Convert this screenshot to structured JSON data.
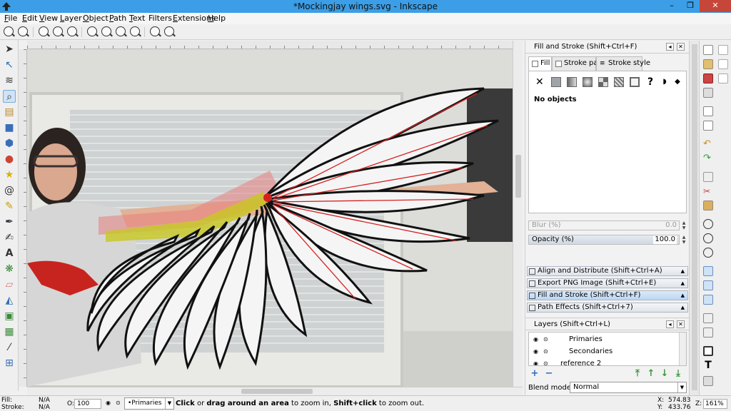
{
  "window": {
    "title": "*Mockingjay wings.svg - Inkscape",
    "minimize": "–",
    "maximize": "❐",
    "close": "✕"
  },
  "menu": [
    {
      "u": "F",
      "rest": "ile"
    },
    {
      "u": "E",
      "rest": "dit"
    },
    {
      "u": "V",
      "rest": "iew"
    },
    {
      "u": "L",
      "rest": "ayer"
    },
    {
      "u": "O",
      "rest": "bject"
    },
    {
      "u": "P",
      "rest": "ath"
    },
    {
      "u": "T",
      "rest": "ext"
    },
    {
      "u": "",
      "rest": "Filters"
    },
    {
      "u": "E",
      "rest": "xtensions"
    },
    {
      "u": "H",
      "rest": "elp"
    }
  ],
  "fill_stroke": {
    "header": "Fill and Stroke (Shift+Ctrl+F)",
    "tabs": {
      "fill": "Fill",
      "stroke_paint": "Stroke paint",
      "stroke_style": "Stroke style"
    },
    "no_objects": "No objects",
    "blur_label": "Blur (%)",
    "blur_value": "0.0",
    "opacity_label": "Opacity (%)",
    "opacity_value": "100.0"
  },
  "docks": {
    "align": "Align and Distribute (Shift+Ctrl+A)",
    "export": "Export PNG Image (Shift+Ctrl+E)",
    "fill_stroke": "Fill and Stroke (Shift+Ctrl+F)",
    "path_effects": "Path Effects  (Shift+Ctrl+7)",
    "layers": "Layers (Shift+Ctrl+L)"
  },
  "layers": {
    "items": [
      "Primaries",
      "Secondaries",
      "reference 2"
    ],
    "blend_label": "Blend mode:",
    "blend_value": "Normal"
  },
  "status": {
    "fill_label": "Fill:",
    "stroke_label": "Stroke:",
    "fill_value": "N/A",
    "stroke_value": "N/A",
    "opacity_label": "O:",
    "opacity_value": "100",
    "current_layer": "•Primaries",
    "message_b1": "Click",
    "message_t1": " or ",
    "message_b2": "drag around an area",
    "message_t2": " to zoom in, ",
    "message_b3": "Shift+click",
    "message_t3": " to zoom out.",
    "x_label": "X:",
    "x_value": "574.83",
    "y_label": "Y:",
    "y_value": "433.76",
    "z_label": "Z:",
    "zoom_value": "161%"
  }
}
